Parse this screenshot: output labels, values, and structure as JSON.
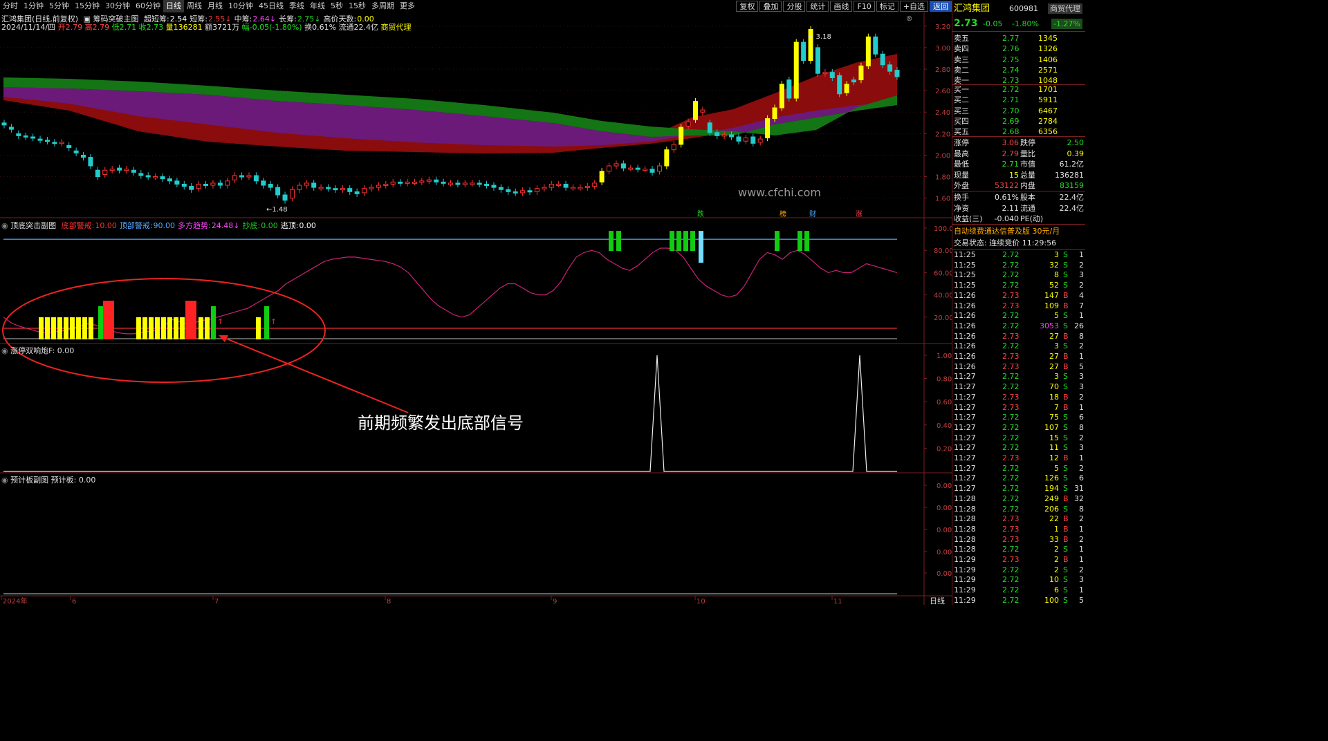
{
  "toolbar": {
    "timeframes": [
      "分时",
      "1分钟",
      "5分钟",
      "15分钟",
      "30分钟",
      "60分钟",
      "日线",
      "周线",
      "月线",
      "10分钟",
      "45日线",
      "季线",
      "年线",
      "5秒",
      "15秒",
      "多周期",
      "更多"
    ],
    "active_index": 6,
    "right_buttons": [
      "复权",
      "叠加",
      "分股",
      "统计",
      "画线",
      "F10",
      "标记",
      "+自选",
      "返回"
    ]
  },
  "info": {
    "stock_line": "汇鸿集团(日线,前复权)",
    "indicator_name": "筹码突破主图",
    "ind_items": [
      {
        "label": "超短筹:",
        "value": "2.54",
        "color": "#ffffff"
      },
      {
        "label": "短筹:",
        "value": "2.55",
        "color": "#ff3333",
        "arrow": "↓"
      },
      {
        "label": "中筹:",
        "value": "2.64",
        "color": "#ff44ff",
        "arrow": "↓"
      },
      {
        "label": "长筹:",
        "value": "2.75",
        "color": "#22cc22",
        "arrow": "↓"
      },
      {
        "label": "高价天数:",
        "value": "0.00",
        "color": "#ffff00"
      }
    ],
    "date": "2024/11/14/四",
    "open": "开2.79",
    "high": "高2.79",
    "low": "低2.71",
    "close": "收2.73",
    "vol": "量136281",
    "amount": "额3721万",
    "change": "幅-0.05(-1.80%)",
    "turnover": "换0.61%",
    "float": "流通22.4亿",
    "sector": "商贸代理"
  },
  "main_chart": {
    "y_labels": [
      "3.20",
      "3.00",
      "2.80",
      "2.60",
      "2.40",
      "2.20",
      "2.00",
      "1.80",
      "1.60"
    ],
    "high_label": "3.18",
    "low_label": "1.48",
    "watermark": "www.cfchi.com",
    "markers": [
      "跌",
      "榜",
      "财",
      "涨"
    ]
  },
  "sub1": {
    "title": "顶底突击副图",
    "items": [
      {
        "label": "底部警戒:",
        "value": "10.00",
        "color": "#ff3333"
      },
      {
        "label": "顶部警戒:",
        "value": "90.00",
        "color": "#55aaff"
      },
      {
        "label": "多方趋势:",
        "value": "24.48",
        "color": "#ff44ff",
        "arrow": "↓"
      },
      {
        "label": "抄底:",
        "value": "0.00",
        "color": "#22cc22"
      },
      {
        "label": "逃顶:",
        "value": "0.00",
        "color": "#ffffff"
      }
    ],
    "y_labels": [
      "100.0",
      "80.00",
      "60.00",
      "40.00",
      "20.00"
    ]
  },
  "sub2": {
    "title": "涨停双响炮F:",
    "value": "0.00",
    "y_labels": [
      "1.00",
      "0.80",
      "0.60",
      "0.40",
      "0.20"
    ]
  },
  "sub3": {
    "title": "预计板副图",
    "label": "预计板:",
    "value": "0.00",
    "y_labels": [
      "0.00",
      "0.00",
      "0.00",
      "0.00",
      "0.00"
    ]
  },
  "annotation": "前期频繁发出底部信号",
  "x_axis": {
    "labels": [
      "2024年",
      "6",
      "7",
      "8",
      "9",
      "10",
      "11"
    ],
    "period": "日线"
  },
  "quote": {
    "name": "汇鸿集团",
    "code": "600981",
    "badge": "商贸代理",
    "price": "2.73",
    "change": "-0.05",
    "pct": "-1.80%",
    "pct_box": "-1.27%",
    "asks": [
      {
        "label": "卖五",
        "price": "2.77",
        "vol": "1345"
      },
      {
        "label": "卖四",
        "price": "2.76",
        "vol": "1326"
      },
      {
        "label": "卖三",
        "price": "2.75",
        "vol": "1406"
      },
      {
        "label": "卖二",
        "price": "2.74",
        "vol": "2571"
      },
      {
        "label": "卖一",
        "price": "2.73",
        "vol": "1048"
      }
    ],
    "bids": [
      {
        "label": "买一",
        "price": "2.72",
        "vol": "1701"
      },
      {
        "label": "买二",
        "price": "2.71",
        "vol": "5911"
      },
      {
        "label": "买三",
        "price": "2.70",
        "vol": "6467"
      },
      {
        "label": "买四",
        "price": "2.69",
        "vol": "2784"
      },
      {
        "label": "买五",
        "price": "2.68",
        "vol": "6356"
      }
    ],
    "stats": [
      {
        "l1": "涨停",
        "v1": "3.06",
        "c1": "#ff4444",
        "l2": "跌停",
        "v2": "2.50",
        "c2": "#22dd22"
      },
      {
        "l1": "最高",
        "v1": "2.79",
        "c1": "#ff4444",
        "l2": "量比",
        "v2": "0.39",
        "c2": "#ffff00"
      },
      {
        "l1": "最低",
        "v1": "2.71",
        "c1": "#22dd22",
        "l2": "市值",
        "v2": "61.2亿",
        "c2": "#e0e0e0"
      },
      {
        "l1": "现量",
        "v1": "15",
        "c1": "#ffff00",
        "l2": "总量",
        "v2": "136281",
        "c2": "#e0e0e0"
      },
      {
        "l1": "外盘",
        "v1": "53122",
        "c1": "#ff4444",
        "l2": "内盘",
        "v2": "83159",
        "c2": "#22dd22"
      }
    ],
    "stats2": [
      {
        "l1": "换手",
        "v1": "0.61%",
        "c1": "#e0e0e0",
        "l2": "股本",
        "v2": "22.4亿",
        "c2": "#e0e0e0"
      },
      {
        "l1": "净资",
        "v1": "2.11",
        "c1": "#e0e0e0",
        "l2": "流通",
        "v2": "22.4亿",
        "c2": "#e0e0e0"
      },
      {
        "l1": "收益(三)",
        "v1": "-0.040",
        "c1": "#e0e0e0",
        "l2": "PE(动)",
        "v2": "",
        "c2": "#e0e0e0"
      }
    ],
    "ad": "自动续费通达信普及版 30元/月",
    "trade_status": "交易状态: 连续竞价 11:29:56",
    "ticks": [
      [
        "11:25",
        "2.72",
        "3",
        "S",
        "1"
      ],
      [
        "11:25",
        "2.72",
        "32",
        "S",
        "2"
      ],
      [
        "11:25",
        "2.72",
        "8",
        "S",
        "3"
      ],
      [
        "11:25",
        "2.72",
        "52",
        "S",
        "2"
      ],
      [
        "11:26",
        "2.73",
        "147",
        "B",
        "4"
      ],
      [
        "11:26",
        "2.73",
        "109",
        "B",
        "7"
      ],
      [
        "11:26",
        "2.72",
        "5",
        "S",
        "1"
      ],
      [
        "11:26",
        "2.72",
        "3053",
        "S",
        "26"
      ],
      [
        "11:26",
        "2.73",
        "27",
        "B",
        "8"
      ],
      [
        "11:26",
        "2.72",
        "3",
        "S",
        "2"
      ],
      [
        "11:26",
        "2.73",
        "27",
        "B",
        "1"
      ],
      [
        "11:26",
        "2.73",
        "27",
        "B",
        "5"
      ],
      [
        "11:27",
        "2.72",
        "3",
        "S",
        "3"
      ],
      [
        "11:27",
        "2.72",
        "70",
        "S",
        "3"
      ],
      [
        "11:27",
        "2.73",
        "18",
        "B",
        "2"
      ],
      [
        "11:27",
        "2.73",
        "7",
        "B",
        "1"
      ],
      [
        "11:27",
        "2.72",
        "75",
        "S",
        "6"
      ],
      [
        "11:27",
        "2.72",
        "107",
        "S",
        "8"
      ],
      [
        "11:27",
        "2.72",
        "15",
        "S",
        "2"
      ],
      [
        "11:27",
        "2.72",
        "11",
        "S",
        "3"
      ],
      [
        "11:27",
        "2.73",
        "12",
        "B",
        "1"
      ],
      [
        "11:27",
        "2.72",
        "5",
        "S",
        "2"
      ],
      [
        "11:27",
        "2.72",
        "126",
        "S",
        "6"
      ],
      [
        "11:27",
        "2.72",
        "194",
        "S",
        "31"
      ],
      [
        "11:28",
        "2.72",
        "249",
        "B",
        "32"
      ],
      [
        "11:28",
        "2.72",
        "206",
        "S",
        "8"
      ],
      [
        "11:28",
        "2.73",
        "22",
        "B",
        "2"
      ],
      [
        "11:28",
        "2.73",
        "1",
        "B",
        "1"
      ],
      [
        "11:28",
        "2.73",
        "33",
        "B",
        "2"
      ],
      [
        "11:28",
        "2.72",
        "2",
        "S",
        "1"
      ],
      [
        "11:29",
        "2.73",
        "2",
        "B",
        "1"
      ],
      [
        "11:29",
        "2.72",
        "2",
        "S",
        "2"
      ],
      [
        "11:29",
        "2.72",
        "10",
        "S",
        "3"
      ],
      [
        "11:29",
        "2.72",
        "6",
        "S",
        "1"
      ],
      [
        "11:29",
        "2.72",
        "100",
        "S",
        "5"
      ]
    ]
  },
  "colors": {
    "up": "#ff3333",
    "down": "#22cccc",
    "grid": "#7a1f1f",
    "band_green": "#147514",
    "band_purple": "#6b1a7a",
    "band_red": "#8a0c0c",
    "signal_yellow": "#ffff00",
    "signal_red": "#ff2222",
    "signal_green": "#11cc11"
  },
  "chart_data": {
    "type": "candlestick",
    "y_range": [
      1.45,
      3.25
    ],
    "close": [
      2.28,
      2.24,
      2.18,
      2.17,
      2.16,
      2.14,
      2.13,
      2.11,
      2.12,
      2.07,
      2.02,
      1.98,
      1.9,
      1.8,
      1.86,
      1.87,
      1.86,
      1.87,
      1.84,
      1.81,
      1.8,
      1.8,
      1.78,
      1.76,
      1.73,
      1.71,
      1.68,
      1.73,
      1.72,
      1.74,
      1.72,
      1.76,
      1.81,
      1.8,
      1.81,
      1.76,
      1.72,
      1.7,
      1.63,
      1.58,
      1.68,
      1.72,
      1.74,
      1.7,
      1.7,
      1.69,
      1.68,
      1.69,
      1.66,
      1.64,
      1.69,
      1.7,
      1.72,
      1.73,
      1.75,
      1.74,
      1.75,
      1.75,
      1.76,
      1.77,
      1.75,
      1.74,
      1.74,
      1.73,
      1.74,
      1.74,
      1.73,
      1.72,
      1.7,
      1.68,
      1.66,
      1.65,
      1.67,
      1.66,
      1.69,
      1.7,
      1.73,
      1.73,
      1.7,
      1.7,
      1.7,
      1.71,
      1.74,
      1.85,
      1.9,
      1.92,
      1.88,
      1.88,
      1.87,
      1.87,
      1.84,
      1.9,
      2.05,
      2.1,
      2.26,
      2.31,
      2.5,
      2.42,
      2.21,
      2.18,
      2.19,
      2.17,
      2.13,
      2.16,
      2.11,
      2.15,
      2.34,
      2.44,
      2.66,
      2.53,
      3.05,
      2.88,
      3.17,
      2.76,
      2.77,
      2.72,
      2.57,
      2.66,
      2.68,
      2.83,
      3.1,
      2.94,
      2.84,
      2.78,
      2.73
    ],
    "open": [
      2.3,
      2.26,
      2.2,
      2.18,
      2.17,
      2.15,
      2.14,
      2.12,
      2.11,
      2.09,
      2.04,
      2.0,
      1.98,
      1.86,
      1.82,
      1.86,
      1.88,
      1.86,
      1.86,
      1.83,
      1.81,
      1.8,
      1.8,
      1.78,
      1.76,
      1.73,
      1.71,
      1.69,
      1.73,
      1.72,
      1.74,
      1.72,
      1.77,
      1.81,
      1.8,
      1.81,
      1.76,
      1.73,
      1.7,
      1.63,
      1.6,
      1.68,
      1.72,
      1.74,
      1.7,
      1.7,
      1.69,
      1.68,
      1.69,
      1.66,
      1.65,
      1.69,
      1.7,
      1.72,
      1.73,
      1.75,
      1.74,
      1.75,
      1.75,
      1.76,
      1.77,
      1.75,
      1.74,
      1.74,
      1.73,
      1.74,
      1.74,
      1.73,
      1.72,
      1.7,
      1.68,
      1.66,
      1.65,
      1.67,
      1.66,
      1.69,
      1.7,
      1.73,
      1.73,
      1.7,
      1.7,
      1.7,
      1.71,
      1.75,
      1.85,
      1.9,
      1.92,
      1.88,
      1.88,
      1.87,
      1.87,
      1.85,
      1.9,
      2.05,
      2.1,
      2.27,
      2.33,
      2.4,
      2.3,
      2.21,
      2.18,
      2.19,
      2.17,
      2.13,
      2.17,
      2.12,
      2.16,
      2.34,
      2.44,
      2.7,
      2.53,
      3.05,
      2.88,
      3.0,
      2.76,
      2.77,
      2.74,
      2.58,
      2.7,
      2.7,
      2.83,
      3.1,
      2.94,
      2.84,
      2.79
    ]
  }
}
